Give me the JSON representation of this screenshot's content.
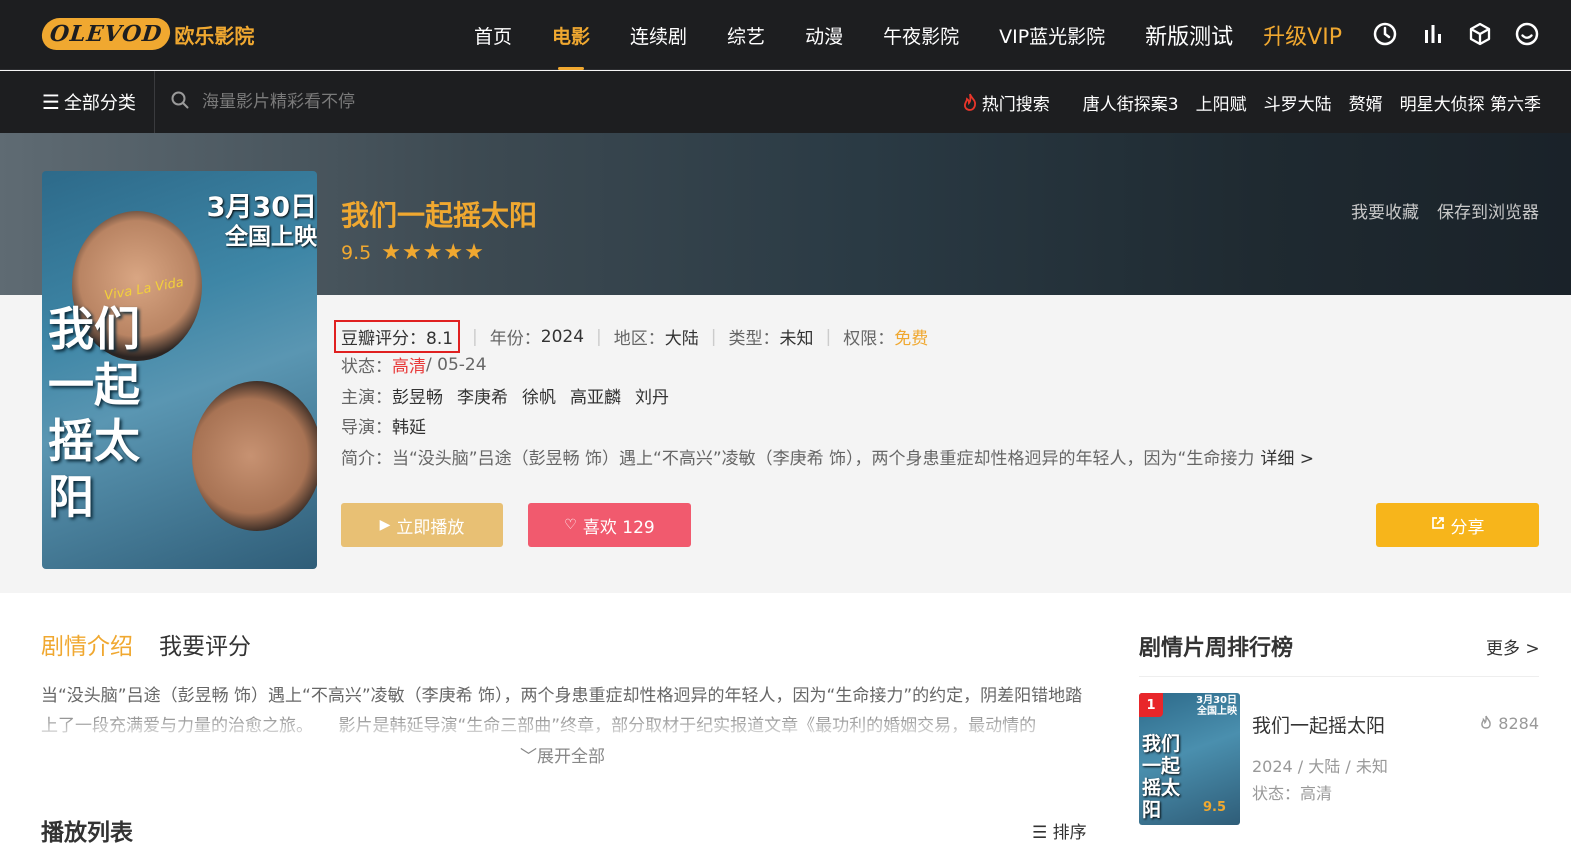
{
  "brand": {
    "logo_badge": "OLEVOD",
    "logo_text": "欧乐影院",
    "accent": "#f0a830"
  },
  "nav": {
    "items": [
      "首页",
      "电影",
      "连续剧",
      "综艺",
      "动漫",
      "午夜影院",
      "VIP蓝光影院"
    ],
    "active_index": 1,
    "test_label": "新版测试",
    "vip_label": "升级VIP",
    "icons": [
      "clock-icon",
      "bar-chart-icon",
      "cube-icon",
      "smile-icon"
    ]
  },
  "subbar": {
    "category_label": "全部分类",
    "search_placeholder": "海量影片精彩看不停",
    "hot_label": "热门搜索",
    "hot_items": [
      "唐人街探案3",
      "上阳赋",
      "斗罗大陆",
      "赘婿",
      "明星大侦探 第六季"
    ]
  },
  "movie": {
    "title": "我们一起摇太阳",
    "score": "9.5",
    "poster_date": "3月30日",
    "poster_release": "全国上映",
    "poster_title": "我们一起摇太阳",
    "poster_script": "Viva La Vida",
    "actions": [
      "我要收藏",
      "保存到浏览器"
    ],
    "douban_label": "豆瓣评分：",
    "douban_value": "8.1",
    "year_label": "年份：",
    "year_value": "2024",
    "region_label": "地区：",
    "region_value": "大陆",
    "type_label": "类型：",
    "type_value": "未知",
    "rights_label": "权限：",
    "rights_value": "免费",
    "status_label": "状态：",
    "status_quality": "高清",
    "status_date": " / 05-24",
    "cast_label": "主演：",
    "cast": [
      "彭昱畅",
      "李庚希",
      "徐帆",
      "高亚麟",
      "刘丹"
    ],
    "director_label": "导演：",
    "director": "韩延",
    "intro_label": "简介：",
    "intro": "当“没头脑”吕途（彭昱畅 饰）遇上“不高兴”凌敏（李庚希 饰），两个身患重症却性格迥异的年轻人，因为“生命接力",
    "intro_more": "详细 >",
    "play_label": "立即播放",
    "like_label": "喜欢 129",
    "share_label": "分享"
  },
  "content": {
    "tabs": [
      "剧情介绍",
      "我要评分"
    ],
    "description": "当“没头脑”吕途（彭昱畅 饰）遇上“不高兴”凌敏（李庚希 饰），两个身患重症却性格迥异的年轻人，因为“生命接力”的约定，阴差阳错地踏上了一段充满爱与力量的治愈之旅。　　影片是韩延导演“生命三部曲”终章，部分取材于纪实报道文章《最功利的婚姻交易，最动情的",
    "expand_label": "展开全部",
    "playlist_title": "播放列表",
    "sort_label": "排序"
  },
  "ranking": {
    "title": "剧情片周排行榜",
    "more_label": "更多 >",
    "items": [
      {
        "rank": "1",
        "name": "我们一起摇太阳",
        "views": "8284",
        "info": "2024 / 大陆 / 未知",
        "status": "状态：高清",
        "thumb_title": "我们一起摇太阳",
        "thumb_score": "9.5",
        "thumb_date": "3月30日",
        "thumb_release": "全国上映"
      }
    ]
  }
}
